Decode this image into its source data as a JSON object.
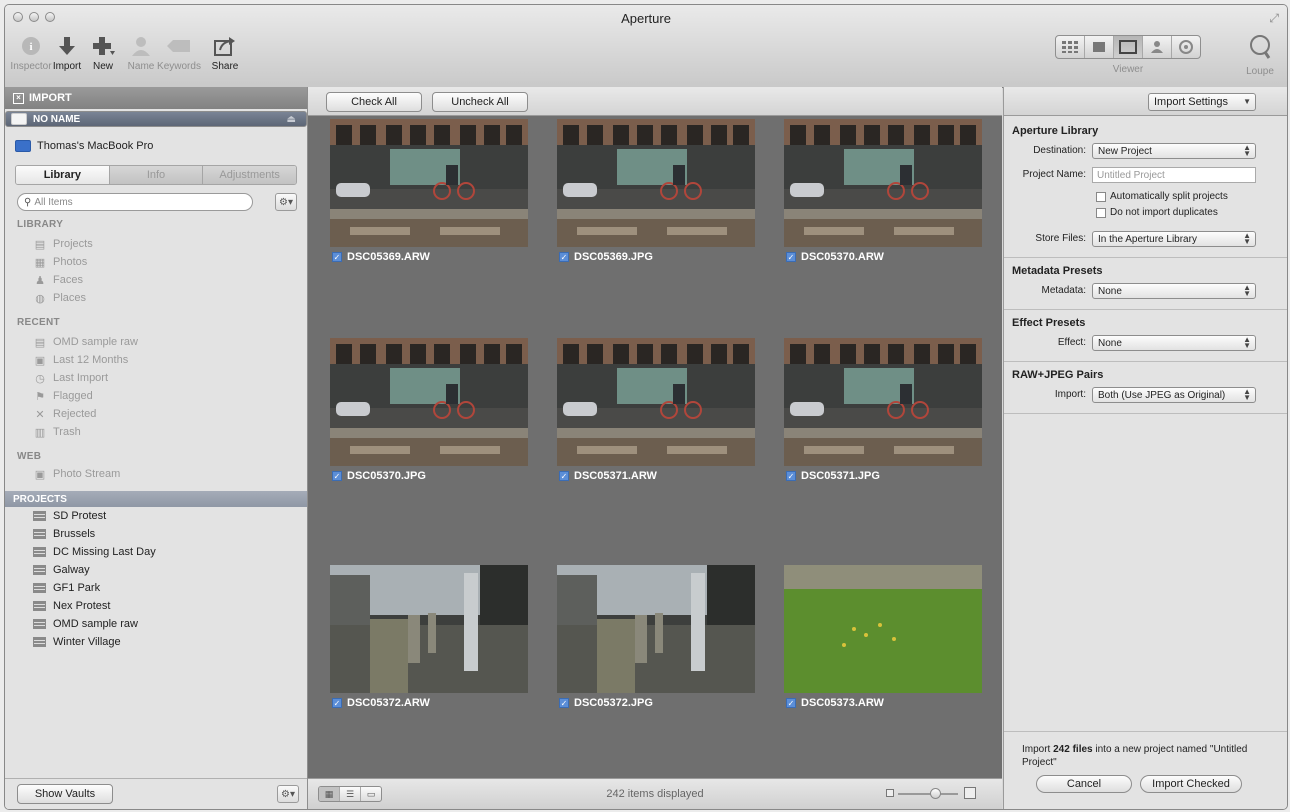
{
  "window": {
    "title": "Aperture"
  },
  "toolbar": {
    "buttons": [
      {
        "label": "Inspector",
        "icon": "info-icon",
        "enabled": false
      },
      {
        "label": "Import",
        "icon": "import-arrow-icon",
        "enabled": true
      },
      {
        "label": "New",
        "icon": "plus-icon",
        "enabled": true
      },
      {
        "label": "Name",
        "icon": "person-icon",
        "enabled": false
      },
      {
        "label": "Keywords",
        "icon": "tag-icon",
        "enabled": false
      },
      {
        "label": "Share",
        "icon": "share-icon",
        "enabled": true
      }
    ],
    "viewer_label": "Viewer",
    "loupe_label": "Loupe"
  },
  "sidebar": {
    "import_header": "IMPORT",
    "sources": [
      {
        "label": "NO NAME",
        "selected": true
      },
      {
        "label": "Thomas's MacBook Pro",
        "selected": false
      }
    ],
    "tabs": [
      "Library",
      "Info",
      "Adjustments"
    ],
    "search_placeholder": "All Items",
    "library_header": "LIBRARY",
    "library_items": [
      "Projects",
      "Photos",
      "Faces",
      "Places"
    ],
    "recent_header": "RECENT",
    "recent_items": [
      "OMD sample raw",
      "Last 12 Months",
      "Last Import",
      "Flagged",
      "Rejected",
      "Trash"
    ],
    "web_header": "WEB",
    "web_items": [
      "Photo Stream"
    ],
    "projects_header": "PROJECTS",
    "projects": [
      "SD Protest",
      "Brussels",
      "DC Missing Last Day",
      "Galway",
      "GF1 Park",
      "Nex Protest",
      "OMD sample raw",
      "Winter Village"
    ],
    "show_vaults_label": "Show Vaults"
  },
  "browser": {
    "check_all_label": "Check All",
    "uncheck_all_label": "Uncheck All",
    "thumbnails": [
      {
        "file": "DSC05369.ARW",
        "scene": "street"
      },
      {
        "file": "DSC05369.JPG",
        "scene": "street"
      },
      {
        "file": "DSC05370.ARW",
        "scene": "street"
      },
      {
        "file": "DSC05370.JPG",
        "scene": "street"
      },
      {
        "file": "DSC05371.ARW",
        "scene": "street"
      },
      {
        "file": "DSC05371.JPG",
        "scene": "street"
      },
      {
        "file": "DSC05372.ARW",
        "scene": "posts"
      },
      {
        "file": "DSC05372.JPG",
        "scene": "posts"
      },
      {
        "file": "DSC05373.ARW",
        "scene": "grass"
      }
    ],
    "status": "242 items displayed"
  },
  "inspector": {
    "import_settings_label": "Import Settings",
    "aperture_library_header": "Aperture Library",
    "destination_label": "Destination:",
    "destination_value": "New Project",
    "project_name_label": "Project Name:",
    "project_name_placeholder": "Untitled Project",
    "split_projects_label": "Automatically split projects",
    "no_duplicates_label": "Do not import duplicates",
    "store_files_label": "Store Files:",
    "store_files_value": "In the Aperture Library",
    "metadata_header": "Metadata Presets",
    "metadata_label": "Metadata:",
    "metadata_value": "None",
    "effect_header": "Effect Presets",
    "effect_label": "Effect:",
    "effect_value": "None",
    "raw_header": "RAW+JPEG Pairs",
    "raw_label": "Import:",
    "raw_value": "Both (Use JPEG as Original)",
    "summary_pre": "Import ",
    "summary_count": "242 files",
    "summary_post": " into a new project named \"Untitled Project\"",
    "cancel_label": "Cancel",
    "import_checked_label": "Import Checked"
  },
  "colors": {
    "selection": "#5d6676",
    "checkbox": "#5b8ed8",
    "browser_bg": "#6f6f6f"
  }
}
